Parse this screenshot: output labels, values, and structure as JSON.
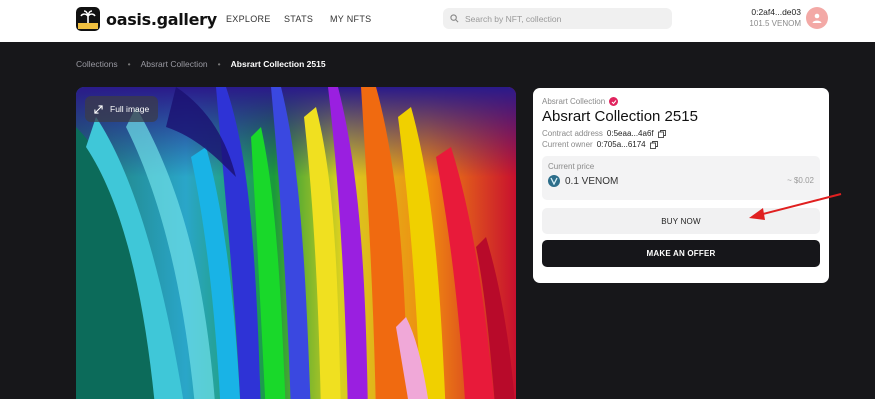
{
  "header": {
    "logo_text": "oasis.gallery",
    "nav": [
      "EXPLORE",
      "STATS",
      "MY NFTS"
    ],
    "search_placeholder": "Search by NFT, collection",
    "wallet_address": "0:2af4...de03",
    "wallet_balance": "101.5 VENOM"
  },
  "breadcrumb": [
    "Collections",
    "Absrart Collection",
    "Absrart Collection 2515"
  ],
  "media": {
    "full_image_label": "Full image"
  },
  "nft": {
    "collection": "Absrart Collection",
    "title": "Absrart Collection 2515",
    "contract_label": "Contract address",
    "contract_value": "0:5eaa...4a6f",
    "owner_label": "Current owner",
    "owner_value": "0:705a...6174",
    "price_label": "Current price",
    "price_value": "0.1 VENOM",
    "price_usd": "~ $0.02",
    "buy_label": "BUY NOW",
    "offer_label": "MAKE AN OFFER"
  },
  "colors": {
    "accent": "#e0245e",
    "dark_bg": "#17171a",
    "annotation_arrow": "#e02020"
  },
  "icons": [
    "logo-icon",
    "search-icon",
    "avatar-icon",
    "expand-icon",
    "verified-icon",
    "copy-icon",
    "venom-token-icon",
    "annotation-arrow-icon"
  ]
}
